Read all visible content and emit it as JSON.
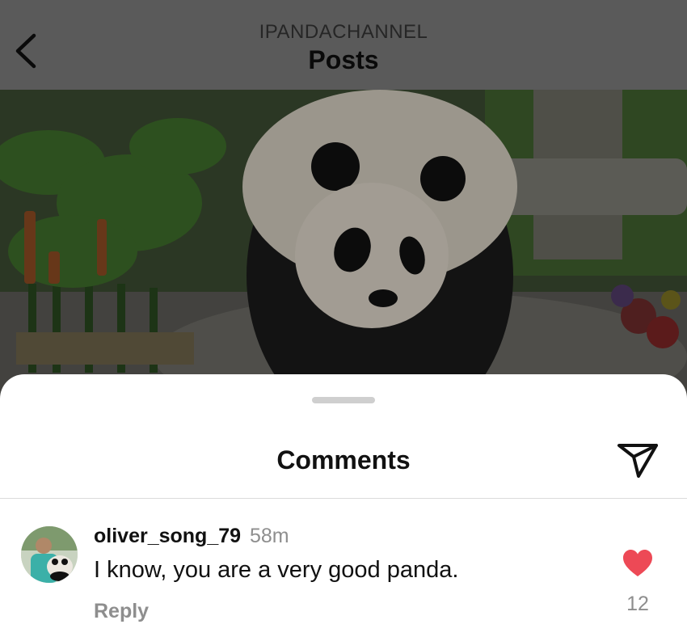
{
  "header": {
    "channel": "IPANDACHANNEL",
    "title": "Posts"
  },
  "sheet": {
    "title": "Comments"
  },
  "comments": [
    {
      "username": "oliver_song_79",
      "time": "58m",
      "text": "I know, you are a very good panda.",
      "reply_label": "Reply",
      "likes": "12",
      "liked": true
    }
  ],
  "colors": {
    "overlay_header": "#5a5a5a",
    "like_red": "#ed4956",
    "muted_text": "#8e8e8e"
  },
  "icons": {
    "back": "chevron-left-icon",
    "share": "send-paper-plane-icon",
    "like": "heart-icon"
  }
}
